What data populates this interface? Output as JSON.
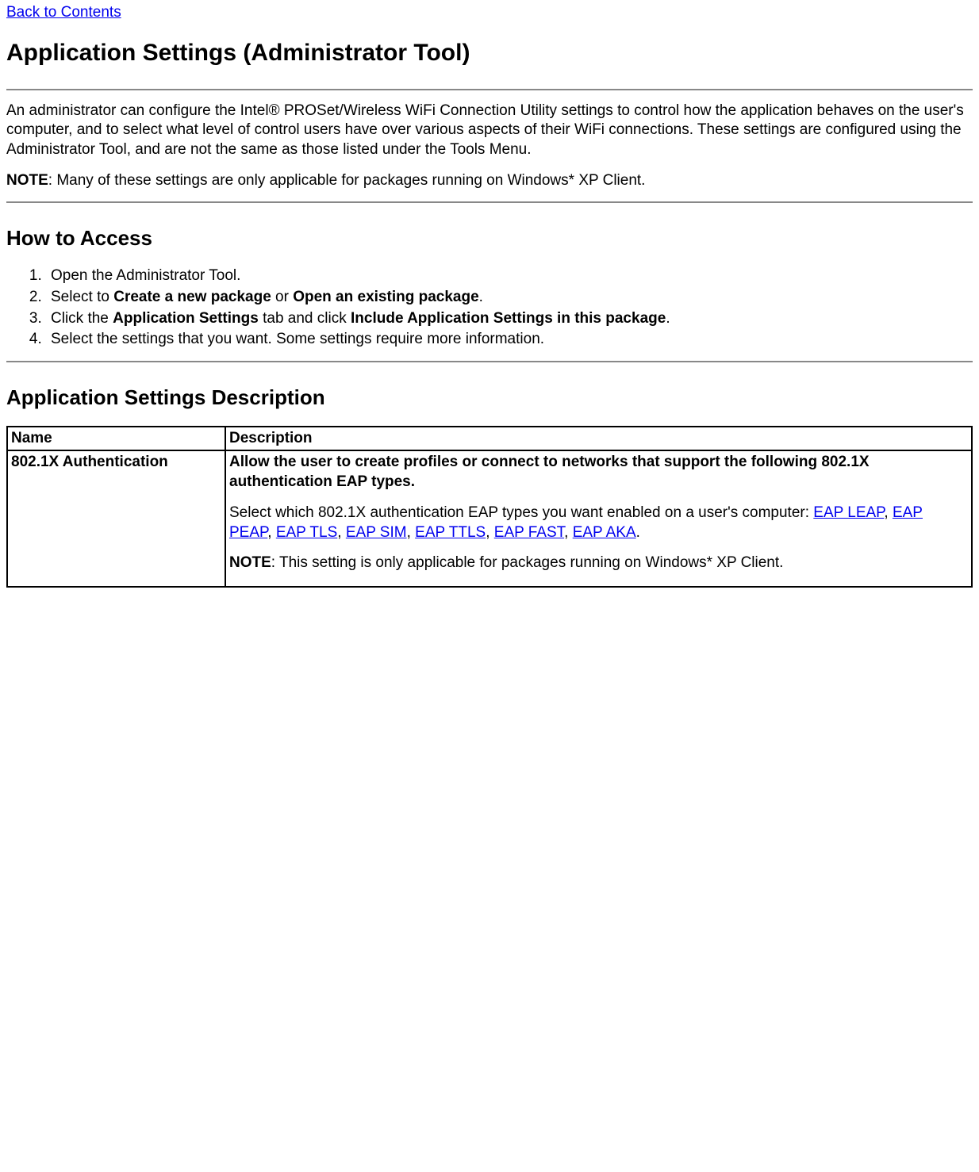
{
  "nav": {
    "back": "Back to Contents"
  },
  "h1": "Application Settings (Administrator Tool)",
  "intro": "An administrator can configure the Intel® PROSet/Wireless WiFi Connection Utility settings to control how the application behaves on the user's computer, and to select what level of control users have over various aspects of their WiFi connections. These settings are configured using the Administrator Tool, and are not the same as those listed under the Tools Menu.",
  "note1_label": "NOTE",
  "note1_text": ": Many of these settings are only applicable for packages running on Windows* XP Client.",
  "h2_access": "How to Access",
  "steps": {
    "s1": "Open the Administrator Tool.",
    "s2_a": "Select to ",
    "s2_b": "Create a new package",
    "s2_c": " or ",
    "s2_d": "Open an existing package",
    "s2_e": ".",
    "s3_a": "Click the ",
    "s3_b": "Application Settings",
    "s3_c": " tab and click ",
    "s3_d": "Include Application Settings in this package",
    "s3_e": ".",
    "s4": "Select the settings that you want. Some settings require more information."
  },
  "h2_desc": "Application Settings Description",
  "table": {
    "header_name": "Name",
    "header_desc": "Description",
    "row1_name": "802.1X Authentication",
    "row1_desc_bold": "Allow the user to create profiles or connect to networks that support the following 802.1X authentication EAP types.",
    "row1_p1": "Select which 802.1X authentication EAP types you want enabled on a user's computer: ",
    "links": {
      "leap": "EAP LEAP",
      "peap": "EAP PEAP",
      "tls": "EAP TLS",
      "sim": "EAP SIM",
      "ttls": "EAP TTLS",
      "fast": "EAP FAST",
      "aka": "EAP AKA"
    },
    "sep": ", ",
    "period": ".",
    "row1_note_label": "NOTE",
    "row1_note_text": ": This setting is only applicable for packages running on Windows* XP Client."
  }
}
